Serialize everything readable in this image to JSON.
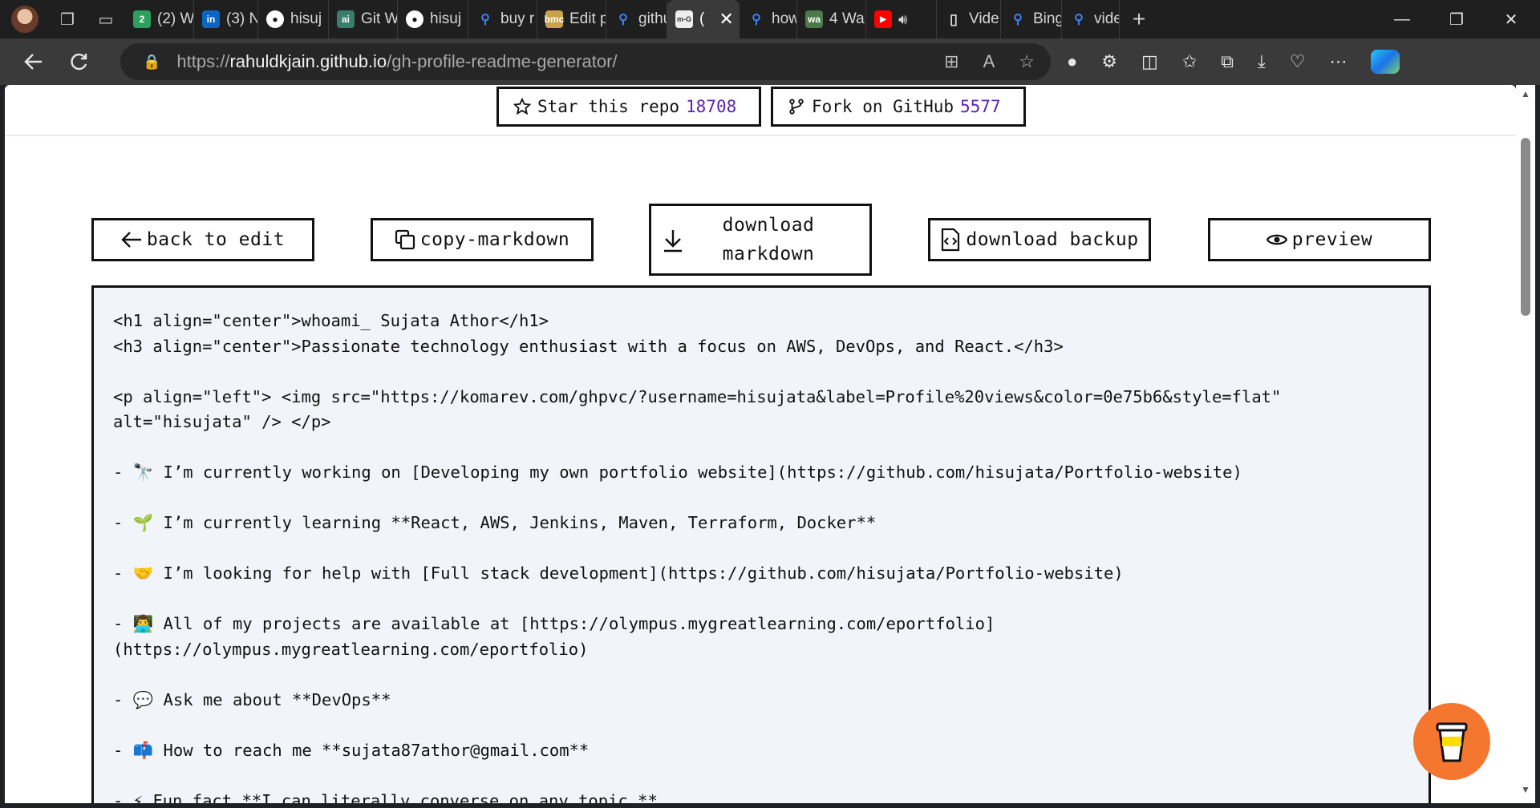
{
  "browser": {
    "tabs": [
      {
        "label": "(2) W",
        "fav": "2",
        "fav_color": "#2e9f5c"
      },
      {
        "label": "(3) N",
        "fav": "in",
        "fav_color": "#0a66c2"
      },
      {
        "label": "hisuj",
        "fav": "gh",
        "fav_color": "#222222"
      },
      {
        "label": "Git W",
        "fav": "ai",
        "fav_color": "#3a7d6b"
      },
      {
        "label": "hisuj",
        "fav": "gh",
        "fav_color": "#222222"
      },
      {
        "label": "buy r",
        "fav": "search",
        "fav_color": "#1f1f1f"
      },
      {
        "label": "Edit p",
        "fav": "bmc",
        "fav_color": "#c8a24a"
      },
      {
        "label": "githu",
        "fav": "search",
        "fav_color": "#1f1f1f"
      },
      {
        "label": "(",
        "fav": "m-G",
        "fav_color": "#eeeeee",
        "active": true
      },
      {
        "label": "how",
        "fav": "search",
        "fav_color": "#1f1f1f"
      },
      {
        "label": "4 Wa",
        "fav": "wa",
        "fav_color": "#4a7a4a"
      },
      {
        "label": "",
        "fav": "yt",
        "fav_color": "#ff0000"
      },
      {
        "label": "Vide",
        "fav": "page",
        "fav_color": "#1f1f1f"
      },
      {
        "label": "Bing",
        "fav": "search",
        "fav_color": "#1f1f1f"
      },
      {
        "label": "vide",
        "fav": "search",
        "fav_color": "#1f1f1f"
      }
    ],
    "url_prefix": "https://",
    "url_host": "rahuldkjain.github.io",
    "url_path": "/gh-profile-readme-generator/"
  },
  "header": {
    "star_label": "Star this repo",
    "star_count": "18708",
    "fork_label": "Fork on GitHub",
    "fork_count": "5577"
  },
  "actions": {
    "back": "back to edit",
    "copy": "copy-markdown",
    "download_md_1": "download",
    "download_md_2": "markdown",
    "download_backup": "download backup",
    "preview": "preview"
  },
  "markdown_lines": [
    "<h1 align=\"center\">whoami_ Sujata Athor</h1>",
    "<h3 align=\"center\">Passionate technology enthusiast with a focus on AWS, DevOps, and React.</h3>",
    "",
    "<p align=\"left\"> <img src=\"https://komarev.com/ghpvc/?username=hisujata&label=Profile%20views&color=0e75b6&style=flat\"",
    "alt=\"hisujata\" /> </p>",
    "",
    "- 🔭 I’m currently working on [Developing my own portfolio website](https://github.com/hisujata/Portfolio-website)",
    "",
    "- 🌱 I’m currently learning **React, AWS, Jenkins, Maven, Terraform, Docker**",
    "",
    "- 🤝 I’m looking for help with [Full stack development](https://github.com/hisujata/Portfolio-website)",
    "",
    "- 👨‍💻 All of my projects are available at [https://olympus.mygreatlearning.com/eportfolio]",
    "(https://olympus.mygreatlearning.com/eportfolio)",
    "",
    "- 💬 Ask me about **DevOps**",
    "",
    "- 📫 How to reach me **sujata87athor@gmail.com**",
    "",
    "- ⚡ Fun fact **I can literally converse on any topic.**"
  ]
}
